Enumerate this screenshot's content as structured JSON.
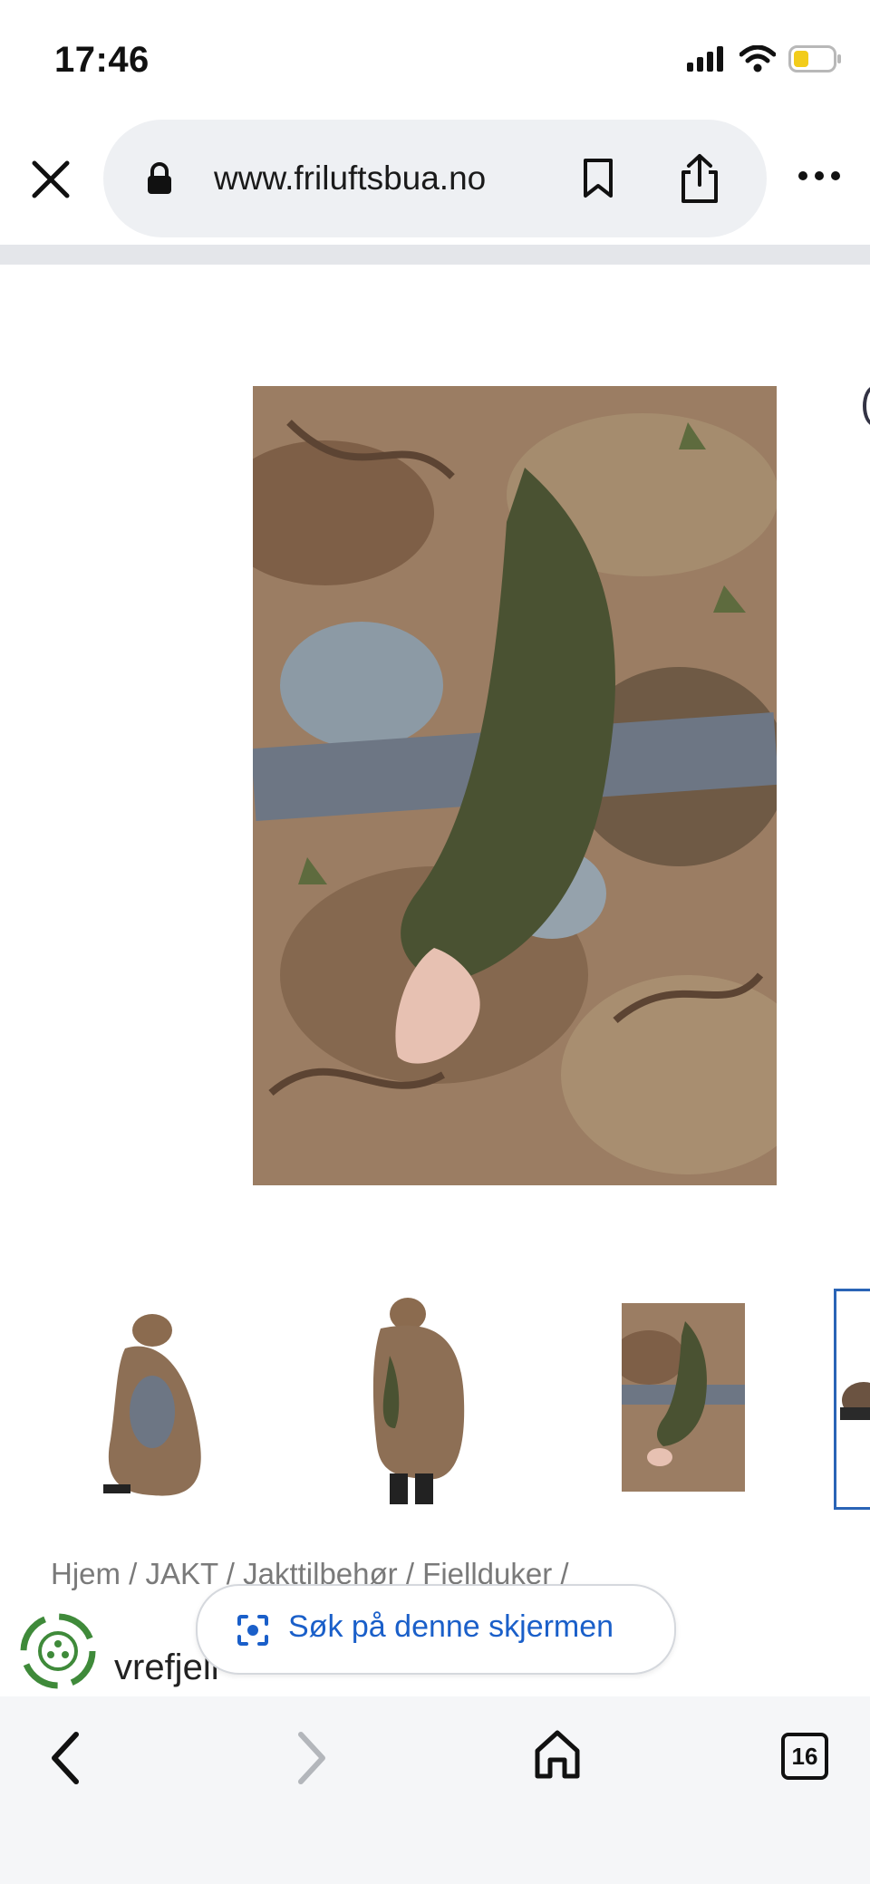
{
  "status_bar": {
    "time": "17:46",
    "icons": [
      "signal-icon",
      "wifi-icon",
      "battery-icon"
    ],
    "battery_color": "#f2cc1a"
  },
  "browser": {
    "url": "www.friluftsbua.no",
    "icons": [
      "close-icon",
      "lock-icon",
      "bookmark-icon",
      "share-icon",
      "more-icon"
    ]
  },
  "product": {
    "main_image_alt": "camo-poncho-detail",
    "thumbnails": [
      {
        "alt": "poncho-seated"
      },
      {
        "alt": "poncho-standing"
      },
      {
        "alt": "poncho-detail"
      },
      {
        "alt": "poncho-partial"
      }
    ],
    "breadcrumb": "Hjem / JAKT / Jakttilbehør / Fjellduker /",
    "title_partial": "vrefjell"
  },
  "lens": {
    "label": "Søk på denne skjermen",
    "accent": "#1a5fc9"
  },
  "bottom_nav": {
    "tabs_count": "16",
    "icons": [
      "back-icon",
      "forward-icon",
      "home-icon",
      "tabs-icon"
    ]
  }
}
